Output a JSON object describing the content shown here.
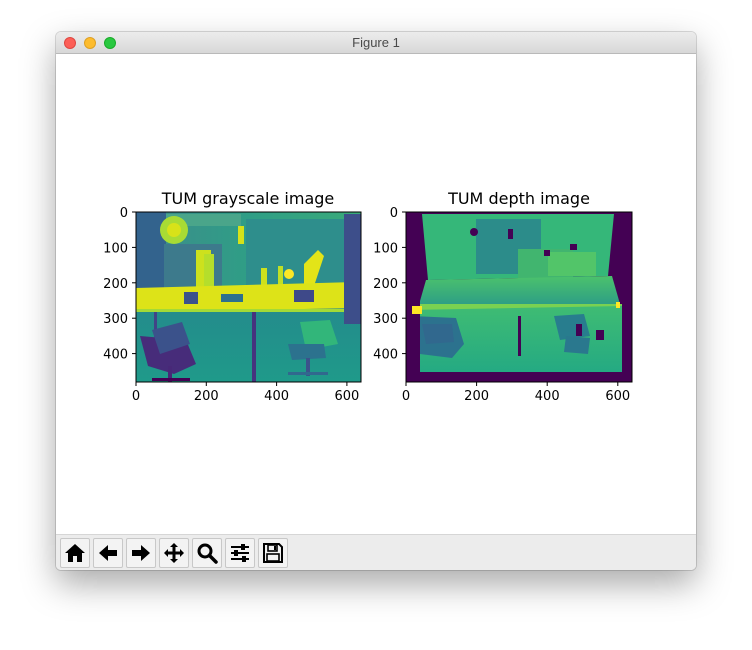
{
  "window": {
    "title": "Figure 1"
  },
  "figure": {
    "subplots": [
      {
        "title": "TUM grayscale image",
        "image": "grayscale office scene rendered with viridis colormap",
        "xticks": [
          "0",
          "200",
          "400",
          "600"
        ],
        "yticks": [
          "0",
          "100",
          "200",
          "300",
          "400"
        ]
      },
      {
        "title": "TUM depth image",
        "image": "depth map of office scene rendered with viridis colormap",
        "xticks": [
          "0",
          "200",
          "400",
          "600"
        ],
        "yticks": [
          "0",
          "100",
          "200",
          "300",
          "400"
        ]
      }
    ],
    "colormap": {
      "dark": "#440154",
      "blue": "#3b528b",
      "teal": "#21918c",
      "green": "#5ec962",
      "yellow": "#fde725"
    }
  },
  "toolbar": {
    "buttons": [
      {
        "icon": "home-icon",
        "label": "Home"
      },
      {
        "icon": "back-arrow-icon",
        "label": "Back"
      },
      {
        "icon": "forward-arrow-icon",
        "label": "Forward"
      },
      {
        "icon": "pan-move-icon",
        "label": "Pan"
      },
      {
        "icon": "zoom-magnifier-icon",
        "label": "Zoom"
      },
      {
        "icon": "configure-sliders-icon",
        "label": "Configure subplots"
      },
      {
        "icon": "save-floppy-icon",
        "label": "Save"
      }
    ]
  }
}
